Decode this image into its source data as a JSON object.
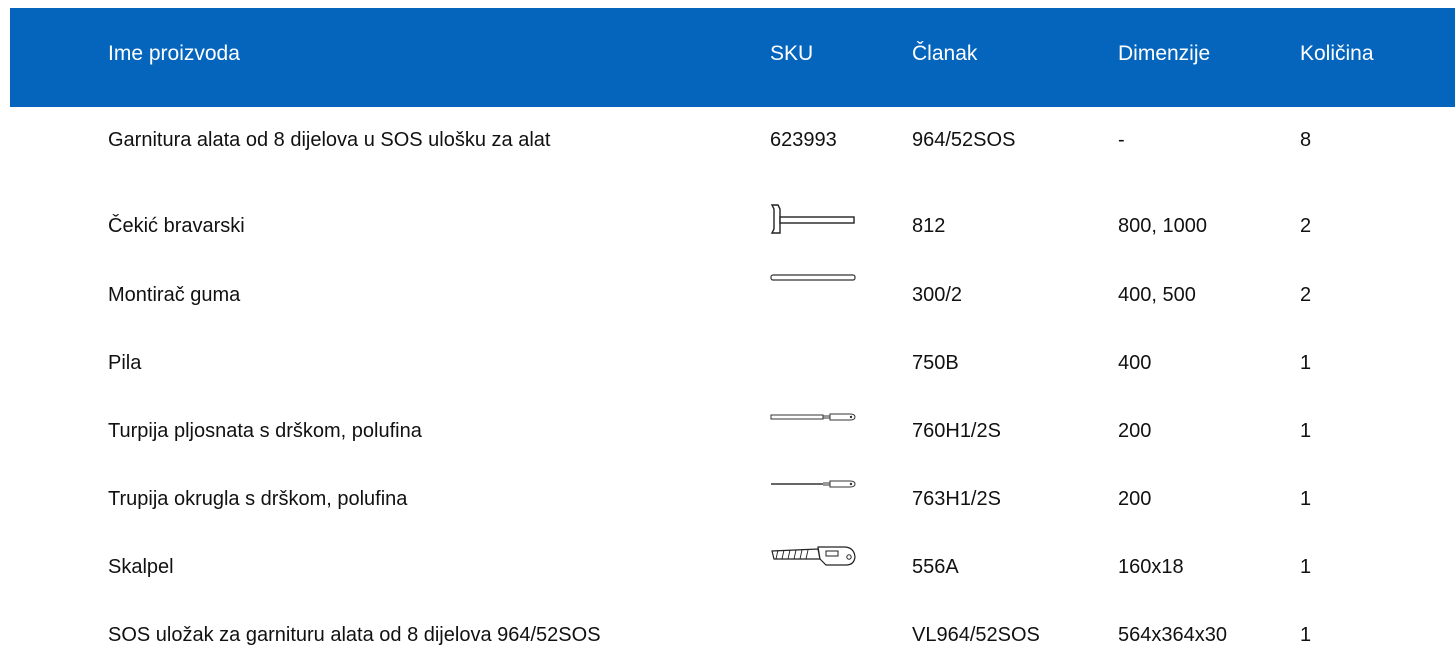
{
  "table": {
    "header": {
      "name": "Ime proizvoda",
      "sku": "SKU",
      "article": "Članak",
      "dimensions": "Dimenzije",
      "quantity": "Količina"
    },
    "header_color": "#0565BD",
    "rows": [
      {
        "name": "Garnitura alata od 8 dijelova u SOS ulošku za alat",
        "sku": "623993",
        "article": "964/52SOS",
        "dimensions": "-",
        "quantity": "8"
      },
      {
        "name": "Čekić bravarski",
        "sku_icon": "hammer-icon",
        "article": "812",
        "dimensions": "800, 1000",
        "quantity": "2"
      },
      {
        "name": "Montirač guma",
        "sku_icon": "tire-lever-icon",
        "article": "300/2",
        "dimensions": "400, 500",
        "quantity": "2"
      },
      {
        "name": "Pila",
        "article": "750B",
        "dimensions": "400",
        "quantity": "1"
      },
      {
        "name": "Turpija pljosnata s drškom, polufina",
        "sku_icon": "flat-file-icon",
        "article": "760H1/2S",
        "dimensions": "200",
        "quantity": "1"
      },
      {
        "name": "Trupija okrugla s drškom, polufina",
        "sku_icon": "round-file-icon",
        "article": "763H1/2S",
        "dimensions": "200",
        "quantity": "1"
      },
      {
        "name": "Skalpel",
        "sku_icon": "utility-knife-icon",
        "article": "556A",
        "dimensions": "160x18",
        "quantity": "1"
      },
      {
        "name": "SOS uložak za garnituru alata od 8 dijelova 964/52SOS",
        "article": "VL964/52SOS",
        "dimensions": "564x364x30",
        "quantity": "1"
      }
    ]
  }
}
